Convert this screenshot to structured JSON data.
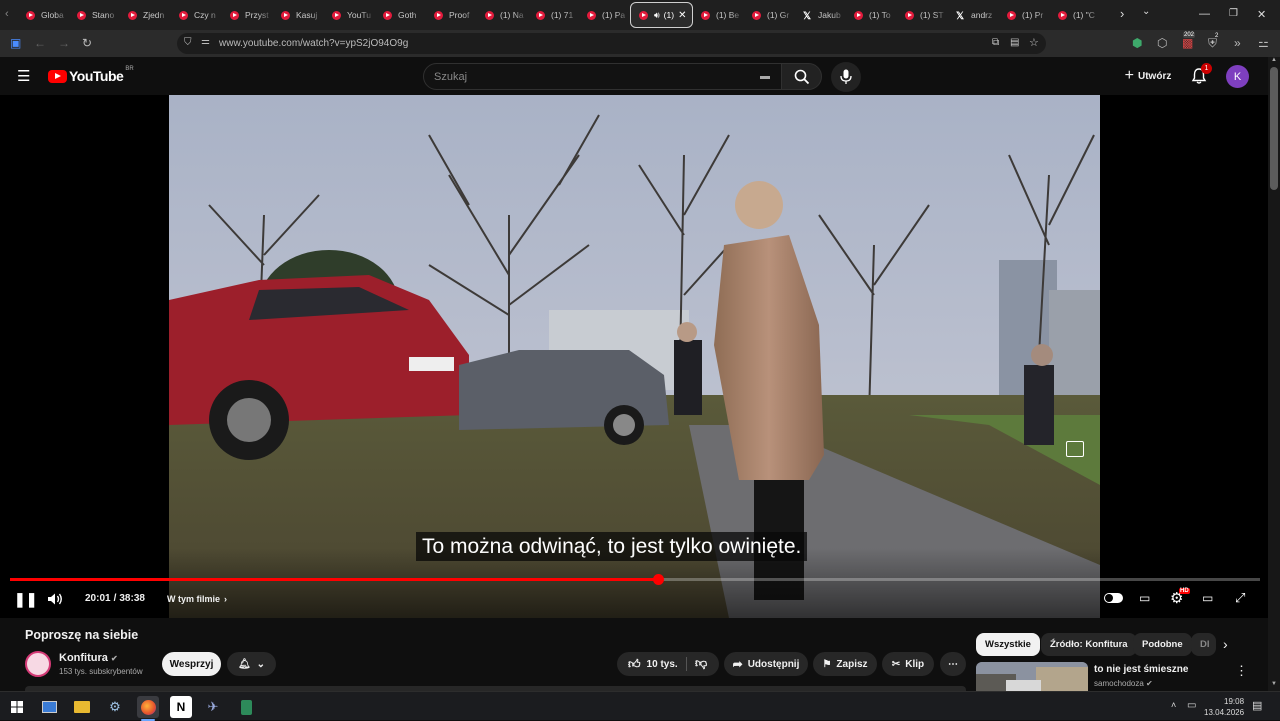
{
  "browser": {
    "tabs": [
      {
        "label": "Globa",
        "icon": "youtube-icon"
      },
      {
        "label": "Stano",
        "icon": "youtube-icon"
      },
      {
        "label": "Zjedn",
        "icon": "youtube-icon"
      },
      {
        "label": "Czy n",
        "icon": "youtube-icon"
      },
      {
        "label": "Przyst",
        "icon": "youtube-icon"
      },
      {
        "label": "Kasuj",
        "icon": "youtube-icon"
      },
      {
        "label": "YouTu",
        "icon": "youtube-icon"
      },
      {
        "label": "Goth",
        "icon": "youtube-icon"
      },
      {
        "label": "Proof",
        "icon": "youtube-icon"
      },
      {
        "label": "(1) Na",
        "icon": "youtube-icon"
      },
      {
        "label": "(1) 71",
        "icon": "youtube-icon"
      },
      {
        "label": "(1) Pa",
        "icon": "youtube-icon"
      },
      {
        "label": "(1)",
        "icon": "youtube-icon",
        "active": true
      },
      {
        "label": "(1) Be",
        "icon": "youtube-icon"
      },
      {
        "label": "(1) Gr",
        "icon": "youtube-icon"
      },
      {
        "label": "Jakub",
        "icon": "x-icon"
      },
      {
        "label": "(1) To",
        "icon": "youtube-icon"
      },
      {
        "label": "(1) ST",
        "icon": "youtube-icon"
      },
      {
        "label": "andrz",
        "icon": "x-icon"
      },
      {
        "label": "(1) Pr",
        "icon": "youtube-icon"
      },
      {
        "label": "(1) \"C",
        "icon": "youtube-icon"
      }
    ],
    "url": "www.youtube.com/watch?v=ypS2jO94O9g",
    "extension_badge": "202",
    "extension_badge2": "2"
  },
  "youtube": {
    "logo_text": "YouTube",
    "country_code": "BR",
    "search_placeholder": "Szukaj",
    "create_label": "Utwórz",
    "notifications_count": "1",
    "avatar_letter": "K"
  },
  "player": {
    "subtitle": "To można odwinąć, to jest tylko owinięte.",
    "time_current": "20:01",
    "time_separator": "/",
    "time_total": "38:38",
    "progress_fraction": 0.5181,
    "chapters_label": "W tym filmie",
    "hd_badge": "HD",
    "is_playing": true
  },
  "video": {
    "title": "Poproszę na siebie",
    "channel_name": "Konfitura",
    "subscribers": "153 tys. subskrybentów",
    "support_label": "Wesprzyj",
    "likes_label": "10 tys.",
    "share_label": "Udostępnij",
    "save_label": "Zapisz",
    "clip_label": "Klip"
  },
  "sidebar": {
    "chips": [
      "Wszystkie",
      "Źródło: Konfitura",
      "Podobne",
      "Dl"
    ],
    "recommended": [
      {
        "title": "to nie jest śmieszne",
        "channel": "samochodoza"
      }
    ]
  },
  "taskbar": {
    "time": "19:08",
    "date": "13.04.2026"
  },
  "colors": {
    "accent_red": "#ff0000",
    "background": "#0f0f0f",
    "avatar": "#7e3fbf"
  }
}
